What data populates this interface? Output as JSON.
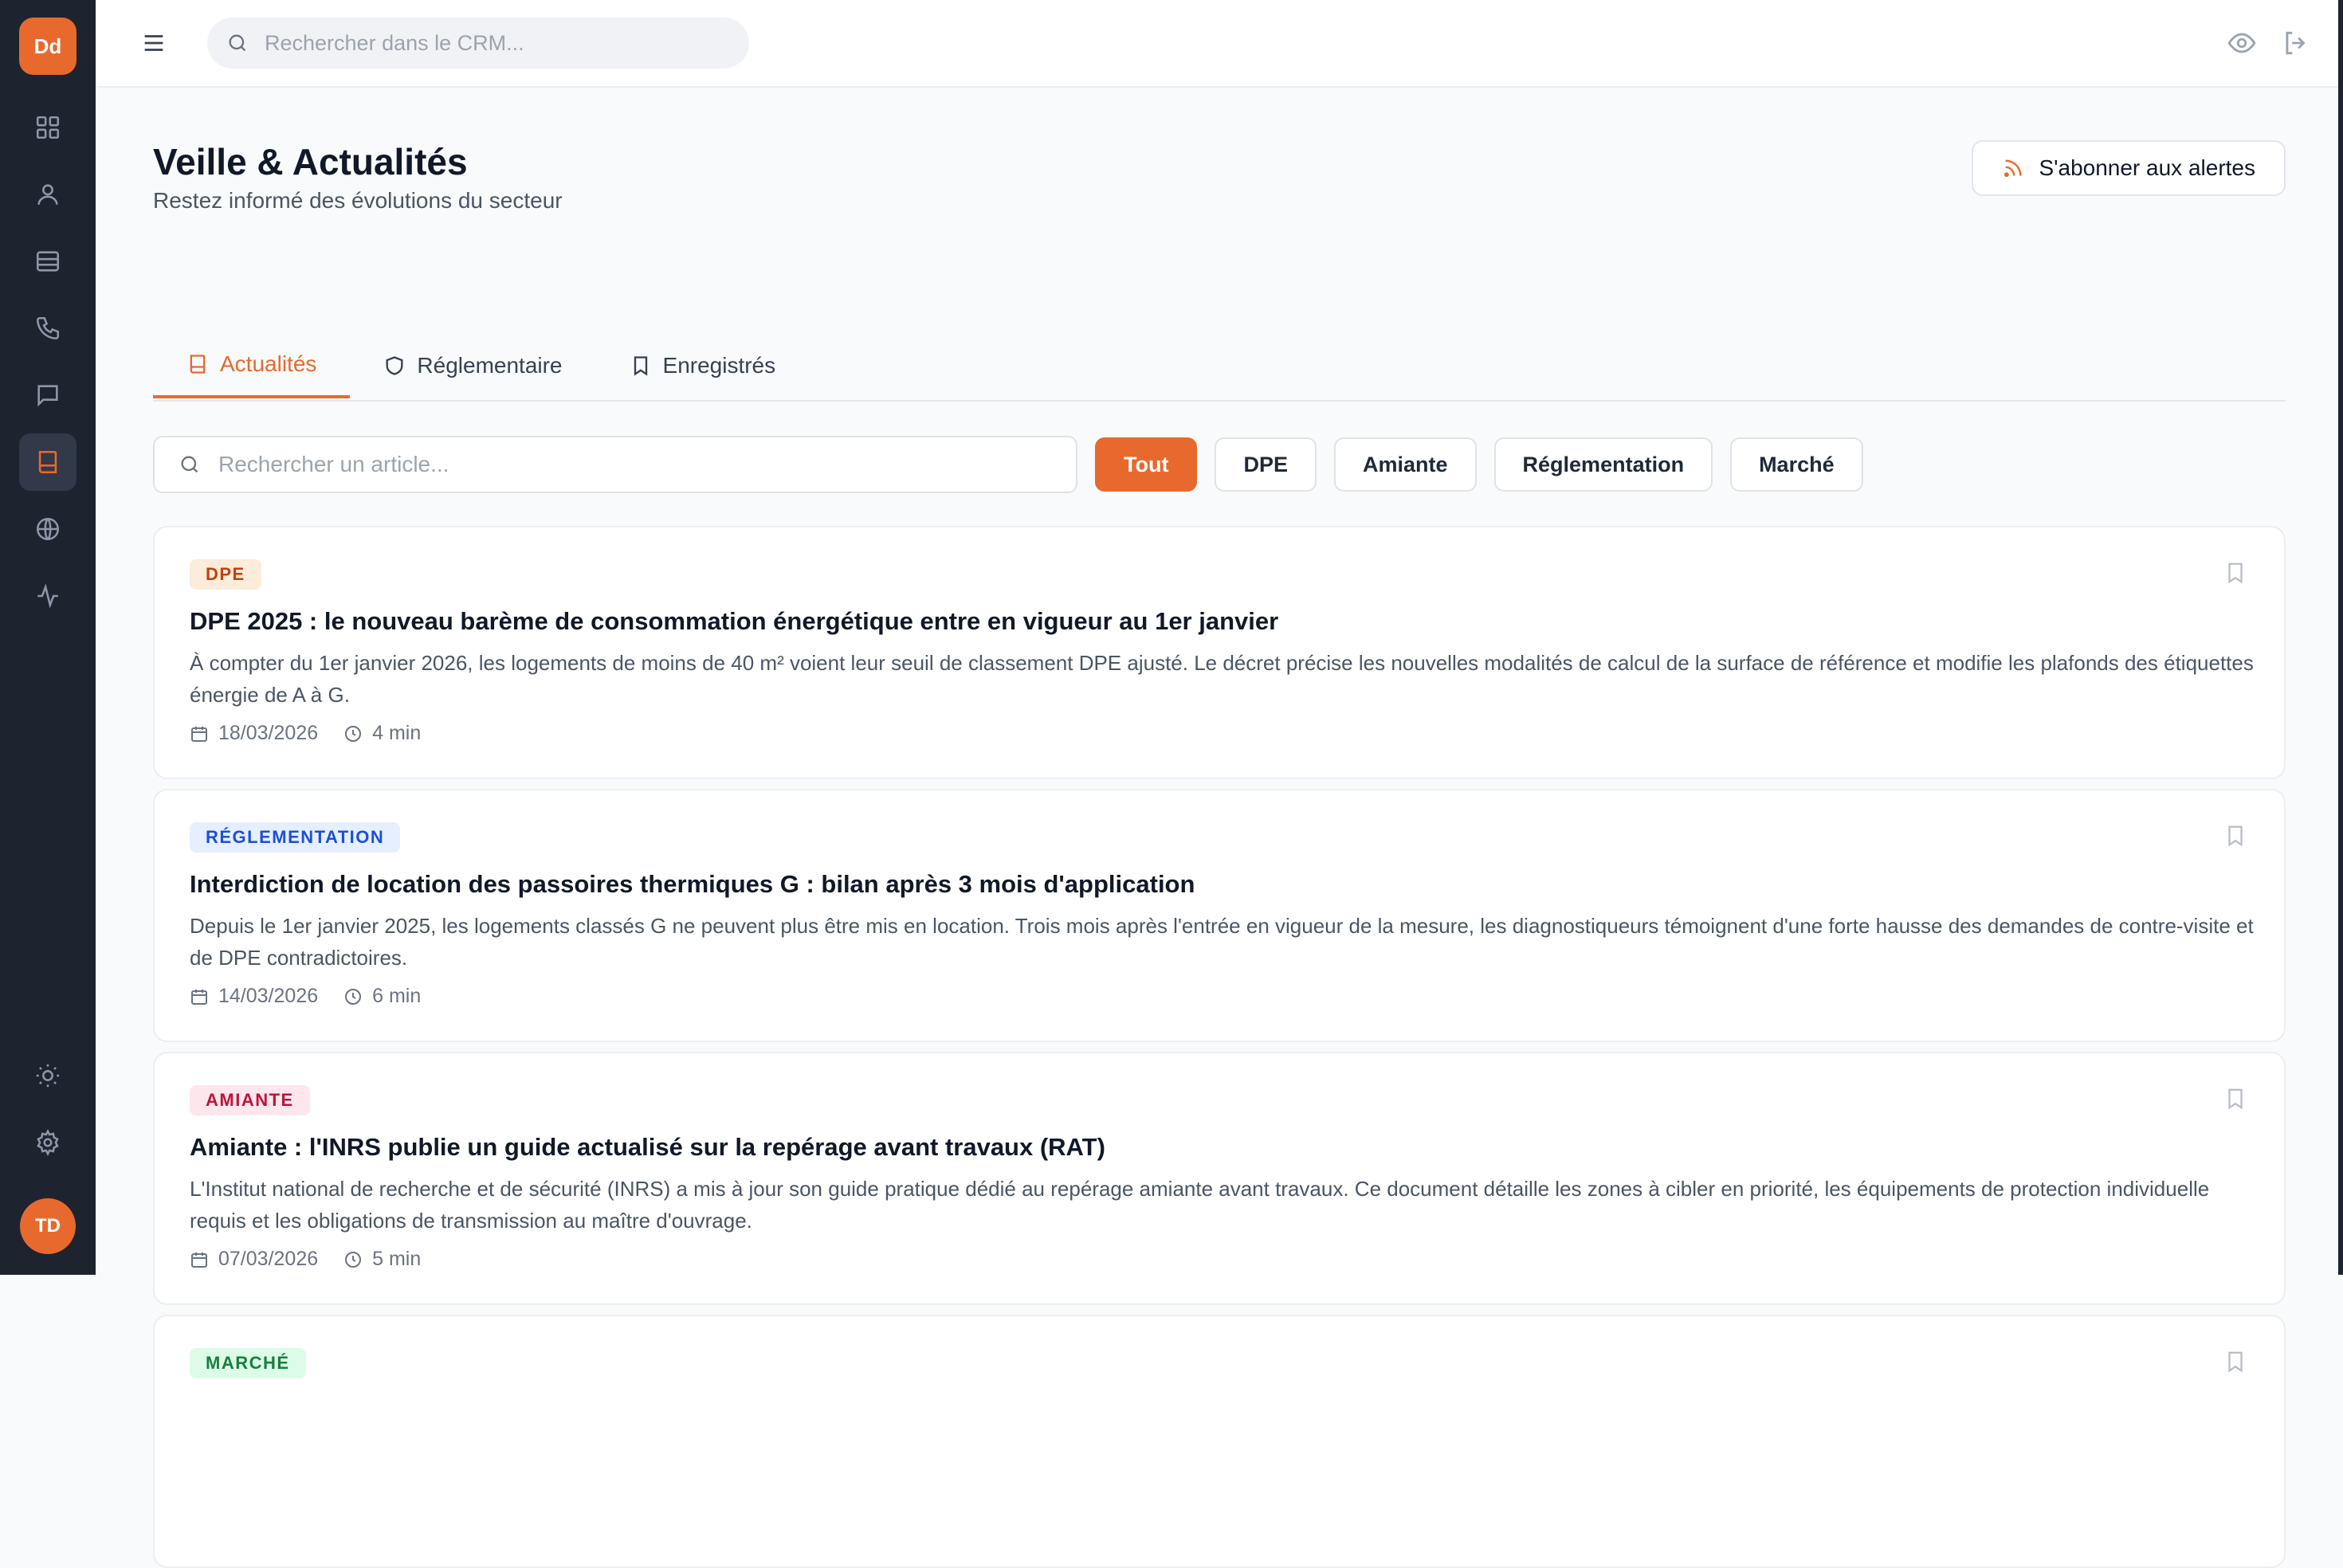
{
  "sidebar": {
    "logo": "Dd",
    "nav": [
      {
        "name": "grid-icon",
        "active": false
      },
      {
        "name": "user-icon",
        "active": false
      },
      {
        "name": "list-icon",
        "active": false
      },
      {
        "name": "phone-icon",
        "active": false
      },
      {
        "name": "chat-icon",
        "active": false
      },
      {
        "name": "book-icon",
        "active": true
      },
      {
        "name": "globe-icon",
        "active": false
      },
      {
        "name": "activity-icon",
        "active": false
      }
    ],
    "bottom_icons": [
      "sun-icon",
      "gear-icon"
    ],
    "user_initials": "TD"
  },
  "topbar": {
    "search_placeholder": "Rechercher dans le CRM...",
    "icons": [
      "eye-icon",
      "logout-icon"
    ]
  },
  "page": {
    "title": "Veille & Actualités",
    "subtitle": "Restez informé des évolutions du secteur",
    "subscribe_label": "S'abonner aux alertes"
  },
  "tabs": [
    {
      "label": "Actualités",
      "icon": "book-icon",
      "active": true
    },
    {
      "label": "Réglementaire",
      "icon": "shield-icon",
      "active": false
    },
    {
      "label": "Enregistrés",
      "icon": "bookmark-icon",
      "active": false
    }
  ],
  "filters": {
    "search_placeholder": "Rechercher un article...",
    "chips": [
      {
        "label": "Tout",
        "active": true
      },
      {
        "label": "DPE",
        "active": false
      },
      {
        "label": "Amiante",
        "active": false
      },
      {
        "label": "Réglementation",
        "active": false
      },
      {
        "label": "Marché",
        "active": false
      }
    ]
  },
  "articles": [
    {
      "tag": "DPE",
      "title": "DPE 2025 : le nouveau barème de consommation énergétique entre en vigueur au 1er janvier",
      "excerpt": "À compter du 1er janvier 2026, les logements de moins de 40 m² voient leur seuil de classement DPE ajusté. Le décret précise les nouvelles modalités de calcul de la surface de référence et modifie les plafonds des étiquettes énergie de A à G.",
      "date": "18/03/2026",
      "read_time": "4 min"
    },
    {
      "tag": "RÉGLEMENTATION",
      "title": "Interdiction de location des passoires thermiques G : bilan après 3 mois d'application",
      "excerpt": "Depuis le 1er janvier 2025, les logements classés G ne peuvent plus être mis en location. Trois mois après l'entrée en vigueur de la mesure, les diagnostiqueurs témoignent d'une forte hausse des demandes de contre-visite et de DPE contradictoires.",
      "date": "14/03/2026",
      "read_time": "6 min"
    },
    {
      "tag": "AMIANTE",
      "title": "Amiante : l'INRS publie un guide actualisé sur la repérage avant travaux (RAT)",
      "excerpt": "L'Institut national de recherche et de sécurité (INRS) a mis à jour son guide pratique dédié au repérage amiante avant travaux. Ce document détaille les zones à cibler en priorité, les équipements de protection individuelle requis et les obligations de transmission au maître d'ouvrage.",
      "date": "07/03/2026",
      "read_time": "5 min"
    },
    {
      "tag": "MARCHÉ"
    }
  ],
  "colors": {
    "accent": "#e8692e",
    "sidebar_bg": "#1e2330",
    "page_bg": "#f9fafb"
  }
}
